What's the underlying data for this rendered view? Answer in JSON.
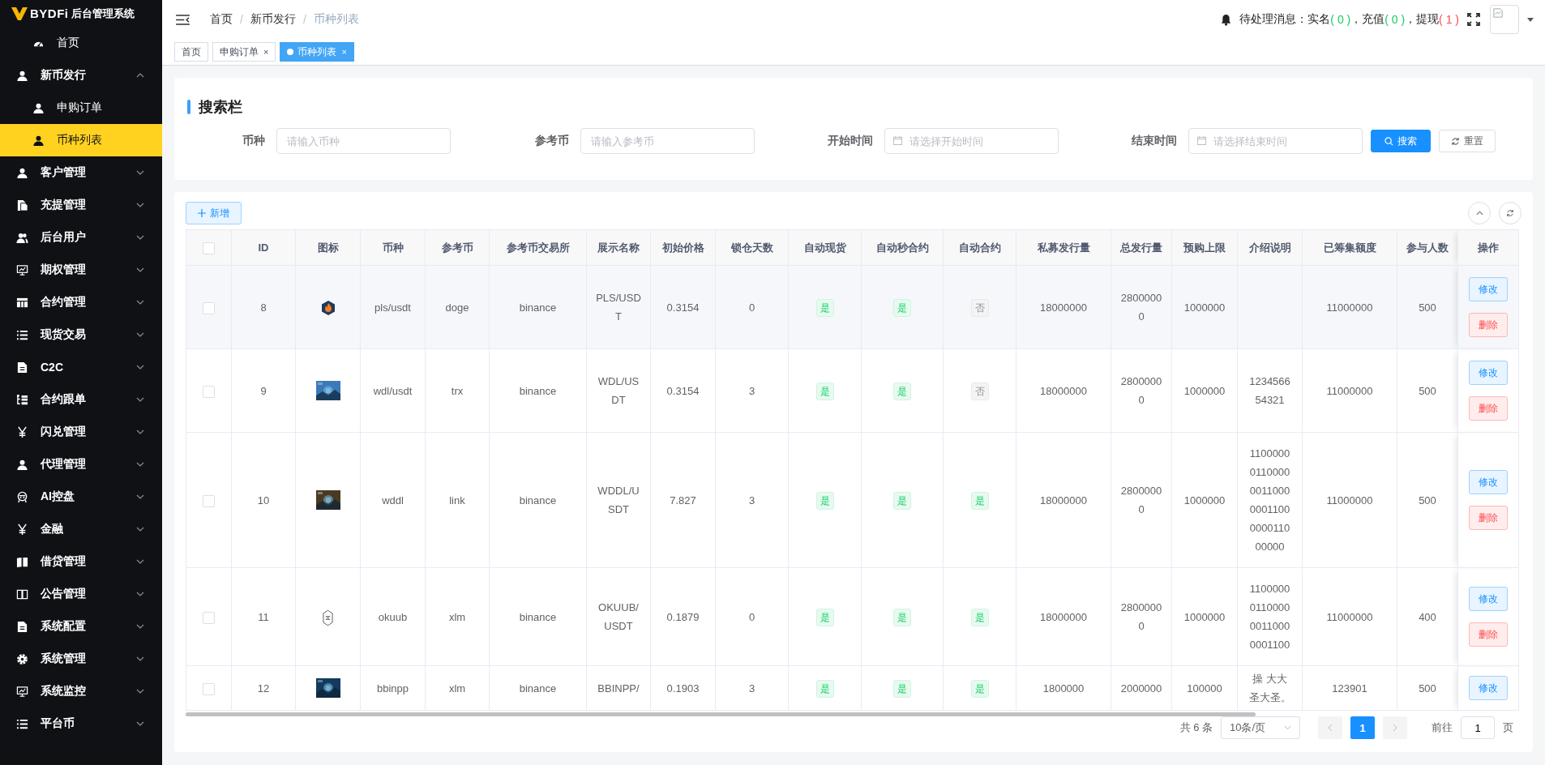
{
  "logo": {
    "brand": "BYDFi",
    "title": "后台管理系统"
  },
  "sidebar": {
    "items": [
      {
        "label": "首页",
        "selected": false
      },
      {
        "label": "新币发行",
        "selected": false,
        "expanded": true,
        "children": [
          {
            "label": "申购订单",
            "selected": false
          },
          {
            "label": "币种列表",
            "selected": true
          }
        ]
      },
      {
        "label": "客户管理",
        "selected": false,
        "expanded": false
      },
      {
        "label": "充提管理",
        "selected": false,
        "expanded": false
      },
      {
        "label": "后台用户",
        "selected": false,
        "expanded": false
      },
      {
        "label": "期权管理",
        "selected": false,
        "expanded": false
      },
      {
        "label": "合约管理",
        "selected": false,
        "expanded": false
      },
      {
        "label": "现货交易",
        "selected": false,
        "expanded": false
      },
      {
        "label": "C2C",
        "selected": false,
        "expanded": false
      },
      {
        "label": "合约跟单",
        "selected": false,
        "expanded": false
      },
      {
        "label": "闪兑管理",
        "selected": false,
        "expanded": false
      },
      {
        "label": "代理管理",
        "selected": false,
        "expanded": false
      },
      {
        "label": "AI控盘",
        "selected": false,
        "expanded": false
      },
      {
        "label": "金融",
        "selected": false,
        "expanded": false
      },
      {
        "label": "借贷管理",
        "selected": false,
        "expanded": false
      },
      {
        "label": "公告管理",
        "selected": false,
        "expanded": false
      },
      {
        "label": "系统配置",
        "selected": false,
        "expanded": false
      },
      {
        "label": "系统管理",
        "selected": false,
        "expanded": false
      },
      {
        "label": "系统监控",
        "selected": false,
        "expanded": false
      },
      {
        "label": "平台币",
        "selected": false,
        "expanded": false
      }
    ]
  },
  "breadcrumb": [
    {
      "label": "首页",
      "separator": "/",
      "current": false
    },
    {
      "label": "新币发行",
      "separator": "/",
      "current": false
    },
    {
      "label": "币种列表",
      "current": true
    }
  ],
  "notice": {
    "label": "待处理消息：",
    "items": [
      {
        "label": "实名",
        "count": "( 0 )",
        "color": "#13ce66"
      },
      {
        "label": "，充值",
        "count": "( 0 )",
        "color": "#13ce66"
      },
      {
        "label": "，提现",
        "count": "( 1 )",
        "color": "#ff4949"
      }
    ]
  },
  "tabs": [
    {
      "label": "首页",
      "selected": false
    },
    {
      "label": "申购订单",
      "selected": false,
      "close": "×"
    },
    {
      "label": "币种列表",
      "selected": true,
      "close": "×"
    }
  ],
  "search": {
    "title": "搜索栏",
    "fields": [
      {
        "label": "币种",
        "placeholder": "请输入币种",
        "kind": "text"
      },
      {
        "label": "参考币",
        "placeholder": "请输入参考币",
        "kind": "text"
      },
      {
        "label": "开始时间",
        "placeholder": "请选择开始时间",
        "kind": "date"
      },
      {
        "label": "结束时间",
        "placeholder": "请选择结束时间",
        "kind": "date"
      }
    ],
    "search_button": "搜索",
    "reset_button": "重置"
  },
  "add_button": "新增",
  "table": {
    "select_all": {
      "checked": false
    },
    "columns": [
      "ID",
      "图标",
      "币种",
      "参考币",
      "参考币交易所",
      "展示名称",
      "初始价格",
      "锁仓天数",
      "自动现货",
      "自动秒合约",
      "自动合约",
      "私募发行量",
      "总发行量",
      "预购上限",
      "介绍说明",
      "已筹集额度",
      "参与人数",
      "操作"
    ],
    "rows": [
      {
        "selected": false,
        "id": "8",
        "icon": {
          "kind": "flame-logo"
        },
        "coin": "pls/usdt",
        "ref": "doge",
        "exchange": "binance",
        "display": "PLS/USDT",
        "price": "0.3154",
        "lock_days": "0",
        "auto_spot": {
          "label": "是",
          "on": true
        },
        "auto_second": {
          "label": "是",
          "on": true
        },
        "auto_contract": {
          "label": "否",
          "on": false
        },
        "private_supply": "18000000",
        "total_supply": "28000000",
        "presale_limit": "1000000",
        "intro": "",
        "raised": "11000000",
        "participants": "500",
        "actions": [
          {
            "label": "修改",
            "kind": "edit"
          },
          {
            "label": "删除",
            "kind": "delete"
          }
        ]
      },
      {
        "selected": false,
        "id": "9",
        "icon": {
          "kind": "picture"
        },
        "coin": "wdl/usdt",
        "ref": "trx",
        "exchange": "binance",
        "display": "WDL/USDT",
        "price": "0.3154",
        "lock_days": "3",
        "auto_spot": {
          "label": "是",
          "on": true
        },
        "auto_second": {
          "label": "是",
          "on": true
        },
        "auto_contract": {
          "label": "否",
          "on": false
        },
        "private_supply": "18000000",
        "total_supply": "28000000",
        "presale_limit": "1000000",
        "intro": "123456654321",
        "raised": "11000000",
        "participants": "500",
        "actions": [
          {
            "label": "修改",
            "kind": "edit"
          },
          {
            "label": "删除",
            "kind": "delete"
          }
        ]
      },
      {
        "selected": false,
        "id": "10",
        "icon": {
          "kind": "picture"
        },
        "coin": "wddl",
        "ref": "link",
        "exchange": "binance",
        "display": "WDDL/USDT",
        "price": "7.827",
        "lock_days": "3",
        "auto_spot": {
          "label": "是",
          "on": true
        },
        "auto_second": {
          "label": "是",
          "on": true
        },
        "auto_contract": {
          "label": "是",
          "on": true
        },
        "private_supply": "18000000",
        "total_supply": "28000000",
        "presale_limit": "1000000",
        "intro": "11000000110000001100000011000000110 00000",
        "raised": "11000000",
        "participants": "500",
        "actions": [
          {
            "label": "修改",
            "kind": "edit"
          },
          {
            "label": "删除",
            "kind": "delete"
          }
        ]
      },
      {
        "selected": false,
        "id": "11",
        "icon": {
          "kind": "hexagon-logo"
        },
        "coin": "okuub",
        "ref": "xlm",
        "exchange": "binance",
        "display": "OKUUB/USDT",
        "price": "0.1879",
        "lock_days": "0",
        "auto_spot": {
          "label": "是",
          "on": true
        },
        "auto_second": {
          "label": "是",
          "on": true
        },
        "auto_contract": {
          "label": "是",
          "on": true
        },
        "private_supply": "18000000",
        "total_supply": "28000000",
        "presale_limit": "1000000",
        "intro": "1100000011000000110000001100",
        "raised": "11000000",
        "participants": "400",
        "actions": [
          {
            "label": "修改",
            "kind": "edit"
          },
          {
            "label": "删除",
            "kind": "delete"
          }
        ]
      },
      {
        "selected": false,
        "id": "12",
        "icon": {
          "kind": "picture"
        },
        "coin": "bbinpp",
        "ref": "xlm",
        "exchange": "binance",
        "display": "BBINPP/",
        "price": "0.1903",
        "lock_days": "3",
        "auto_spot": {
          "label": "是",
          "on": true
        },
        "auto_second": {
          "label": "是",
          "on": true
        },
        "auto_contract": {
          "label": "是",
          "on": true
        },
        "private_supply": "1800000",
        "total_supply": "2000000",
        "presale_limit": "100000",
        "intro": "操 大大圣大圣。",
        "raised": "123901",
        "participants": "500",
        "actions": [
          {
            "label": "修改",
            "kind": "edit"
          }
        ]
      }
    ]
  },
  "pagination": {
    "total": "共 6 条",
    "page_size": "10条/页",
    "pages": [
      {
        "label": "1",
        "selected": true
      }
    ],
    "goto_label": "前往",
    "goto_value": "1",
    "goto_suffix": "页"
  }
}
